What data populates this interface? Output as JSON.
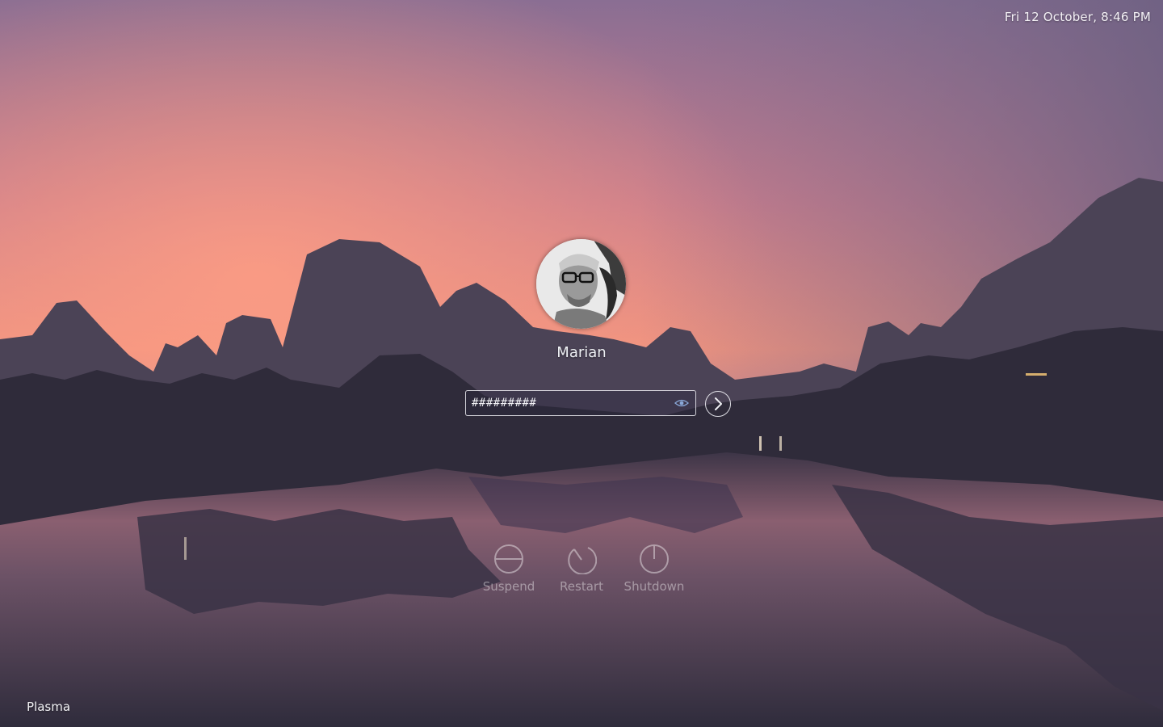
{
  "header": {
    "date": "Fri 12 October,",
    "time": "8:46 PM"
  },
  "user": {
    "name": "Marian"
  },
  "login": {
    "password_value": "#########",
    "reveal_icon": "eye-icon",
    "submit_icon": "chevron-right-icon"
  },
  "actions": [
    {
      "label": "Suspend",
      "icon": "suspend-icon"
    },
    {
      "label": "Restart",
      "icon": "restart-icon"
    },
    {
      "label": "Shutdown",
      "icon": "power-icon"
    }
  ],
  "session": {
    "label": "Plasma"
  },
  "colors": {
    "sky_top": "#8a6e93",
    "sky_glow": "#f3937a",
    "mountains": "#3a3345",
    "water": "#2f2c3c"
  }
}
